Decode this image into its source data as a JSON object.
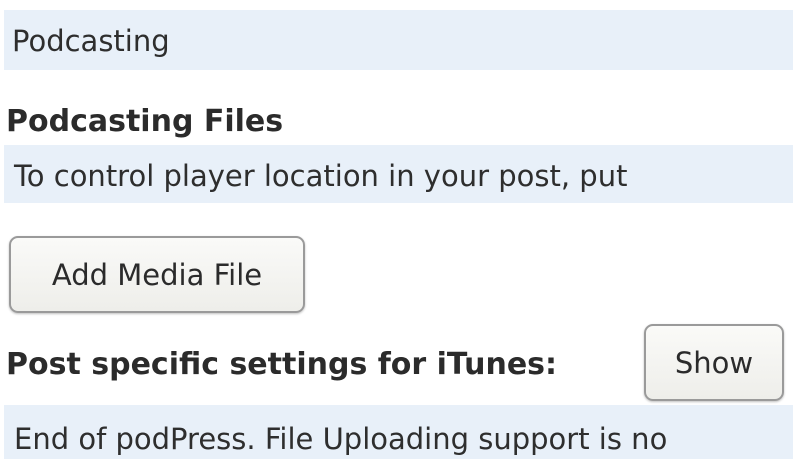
{
  "section": {
    "title": "Podcasting"
  },
  "files": {
    "heading": "Podcasting Files",
    "description": "To control player location in your post, put",
    "add_media_label": "Add Media File"
  },
  "itunes": {
    "heading": "Post specific settings for iTunes:",
    "show_label": "Show"
  },
  "footer": {
    "note": "End of podPress. File Uploading support is no"
  }
}
